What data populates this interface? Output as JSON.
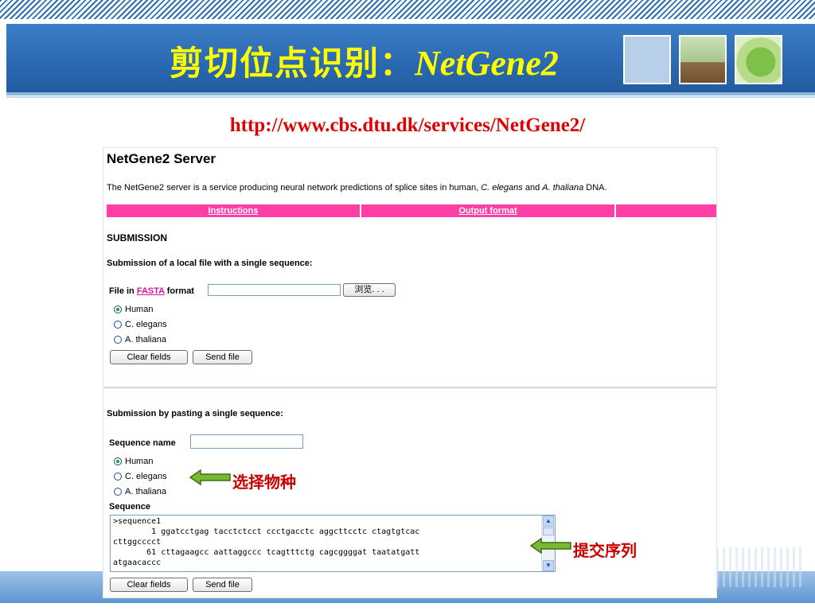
{
  "slide": {
    "title_cn": "剪切位点识别：",
    "title_en": "NetGene2",
    "url": "http://www.cbs.dtu.dk/services/NetGene2/",
    "colors": {
      "title": "#ffff00",
      "url": "#e00000",
      "band": "#2a68b0",
      "note": "#cc0000",
      "arrow": "#7ab833"
    }
  },
  "page": {
    "server_title": "NetGene2 Server",
    "desc_1": "The NetGene2 server is a service producing neural network predictions of splice sites in human, ",
    "desc_c": "C. elegans",
    "desc_and": " and ",
    "desc_a": "A. thaliana",
    "desc_end": " DNA.",
    "nav": [
      "Instructions",
      "Output format",
      ""
    ],
    "nav_color": "#ff3fa6",
    "submission_heading": "SUBMISSION",
    "file_section": {
      "heading": "Submission of a local file with a single sequence:",
      "label_pre": "File in ",
      "label_link": "FASTA",
      "label_post": " format",
      "browse_label": "浏览. . .",
      "species": [
        "Human",
        "C. elegans",
        "A. thaliana"
      ],
      "selected": "Human",
      "clear_label": "Clear fields",
      "send_label": "Send file"
    },
    "paste_section": {
      "heading": "Submission by pasting a single sequence:",
      "name_label": "Sequence name",
      "species": [
        "Human",
        "C. elegans",
        "A. thaliana"
      ],
      "selected": "Human",
      "sequence_label": "Sequence",
      "sequence_text": ">sequence1\n        1 ggatcctgag tacctctcct ccctgacctc aggcttcctc ctagtgtcac\ncttggcccct\n       61 cttagaagcc aattaggccc tcagtttctg cagcggggat taatatgatt\natgaacaccc",
      "clear_label": "Clear fields",
      "send_label": "Send file"
    }
  },
  "annotations": {
    "species_note": "选择物种",
    "sequence_note": "提交序列"
  }
}
